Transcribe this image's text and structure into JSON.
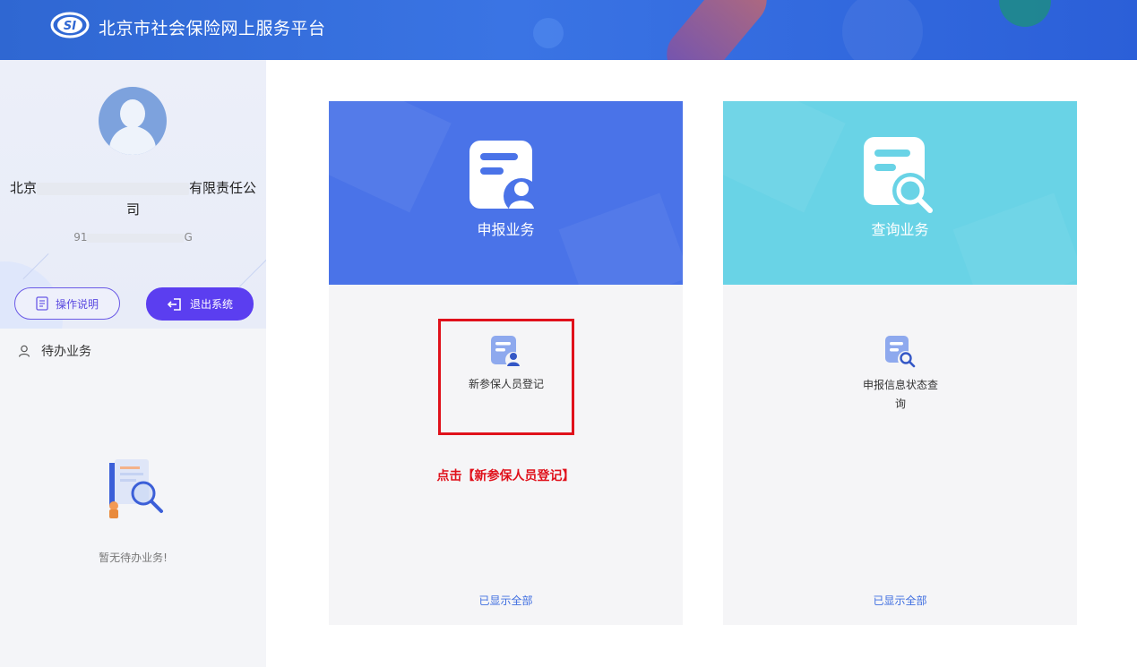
{
  "header": {
    "logo_text": "SI",
    "title": "北京市社会保险网上服务平台"
  },
  "sidebar": {
    "company_prefix": "北京",
    "company_suffix": "有限责任公",
    "company_tail": "司",
    "code_prefix": "91",
    "code_suffix": "G",
    "help_button": "操作说明",
    "logout_button": "退出系统",
    "todo_title": "待办业务",
    "empty_text": "暂无待办业务!"
  },
  "cards": [
    {
      "title": "申报业务",
      "icon": "document-person-icon",
      "items": [
        {
          "label": "新参保人员登记",
          "icon": "document-person-icon"
        }
      ],
      "instruction": "点击【新参保人员登记】",
      "footer": "已显示全部"
    },
    {
      "title": "查询业务",
      "icon": "document-search-icon",
      "items": [
        {
          "label": "申报信息状态查询",
          "icon": "document-search-icon"
        }
      ],
      "footer": "已显示全部"
    }
  ],
  "colors": {
    "header": "#3a74e4",
    "report_card": "#4a73e8",
    "query_card": "#69d3e6",
    "highlight_border": "#e0111b",
    "logout_button": "#5b3ef0",
    "link": "#3f6ee0"
  }
}
